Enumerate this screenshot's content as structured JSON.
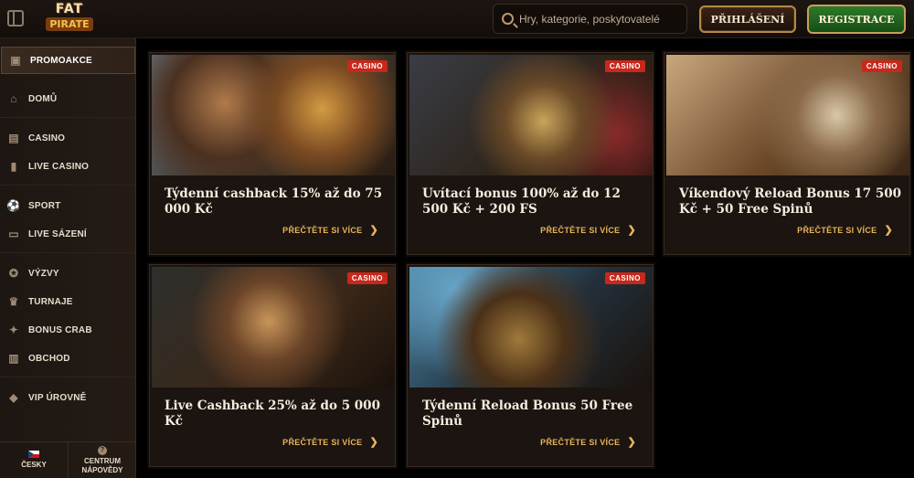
{
  "header": {
    "logo_line1": "FAT",
    "logo_line2": "PIRATE",
    "search_placeholder": "Hry, kategorie, poskytovatelé",
    "login_label": "PŘIHLÁŠENÍ",
    "register_label": "REGISTRACE"
  },
  "sidebar": {
    "items": [
      {
        "label": "PROMOAKCE",
        "icon": "gift-card-icon",
        "active": true
      },
      {
        "label": "DOMŮ",
        "icon": "home-icon"
      },
      {
        "label": "CASINO",
        "icon": "slot-machine-icon"
      },
      {
        "label": "LIVE CASINO",
        "icon": "playing-card-icon"
      },
      {
        "label": "SPORT",
        "icon": "soccer-ball-icon"
      },
      {
        "label": "LIVE SÁZENÍ",
        "icon": "live-tv-icon"
      },
      {
        "label": "VÝZVY",
        "icon": "medal-icon"
      },
      {
        "label": "TURNAJE",
        "icon": "trophy-icon"
      },
      {
        "label": "BONUS CRAB",
        "icon": "crab-icon"
      },
      {
        "label": "OBCHOD",
        "icon": "shopping-basket-icon"
      },
      {
        "label": "VIP ÚROVNĚ",
        "icon": "diamond-icon"
      }
    ],
    "footer": {
      "language_label": "ČESKY",
      "help_line1": "CENTRUM",
      "help_line2": "NÁPOVĚDY"
    }
  },
  "promotions": [
    {
      "badge": "CASINO",
      "title": "Týdenní cashback 15% až do 75 000 Kč",
      "more": "PŘEČTĚTE SI VÍCE"
    },
    {
      "badge": "CASINO",
      "title": "Uvítací bonus 100% až do 12 500 Kč + 200 FS",
      "more": "PŘEČTĚTE SI VÍCE"
    },
    {
      "badge": "CASINO",
      "title": "Víkendový Reload Bonus 17 500 Kč + 50 Free Spinů",
      "more": "PŘEČTĚTE SI VÍCE"
    },
    {
      "badge": "CASINO",
      "title": "Live Cashback 25% až do 5 000 Kč",
      "more": "PŘEČTĚTE SI VÍCE"
    },
    {
      "badge": "CASINO",
      "title": "Týdenní Reload Bonus 50 Free Spinů",
      "more": "PŘEČTĚTE SI VÍCE"
    }
  ]
}
